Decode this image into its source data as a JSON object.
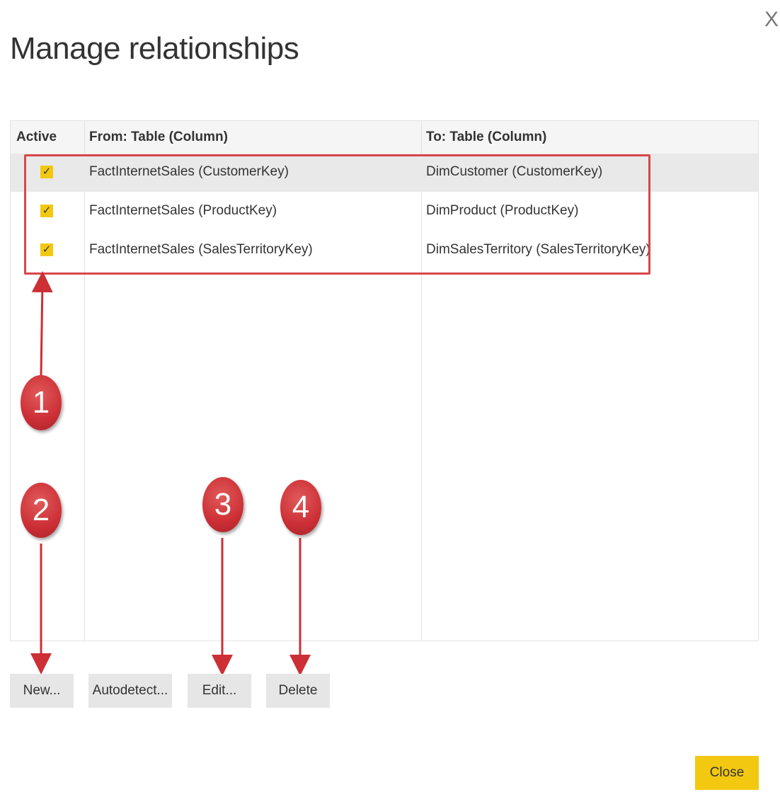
{
  "dialog": {
    "title": "Manage relationships",
    "close_glyph": "X"
  },
  "table": {
    "headers": {
      "active": "Active",
      "from": "From: Table (Column)",
      "to": "To: Table (Column)"
    },
    "rows": [
      {
        "active": true,
        "check": "✓",
        "from": "FactInternetSales (CustomerKey)",
        "to": "DimCustomer (CustomerKey)",
        "selected": true
      },
      {
        "active": true,
        "check": "✓",
        "from": "FactInternetSales (ProductKey)",
        "to": "DimProduct (ProductKey)",
        "selected": false
      },
      {
        "active": true,
        "check": "✓",
        "from": "FactInternetSales (SalesTerritoryKey)",
        "to": "DimSalesTerritory (SalesTerritoryKey)",
        "selected": false
      }
    ]
  },
  "buttons": {
    "new": "New...",
    "autodetect": "Autodetect...",
    "edit": "Edit...",
    "delete": "Delete",
    "close": "Close"
  },
  "annotations": {
    "markers": [
      "1",
      "2",
      "3",
      "4"
    ],
    "color": "#cc2f35"
  },
  "colors": {
    "accent": "#f2c811",
    "highlight_border": "#d9464b"
  }
}
